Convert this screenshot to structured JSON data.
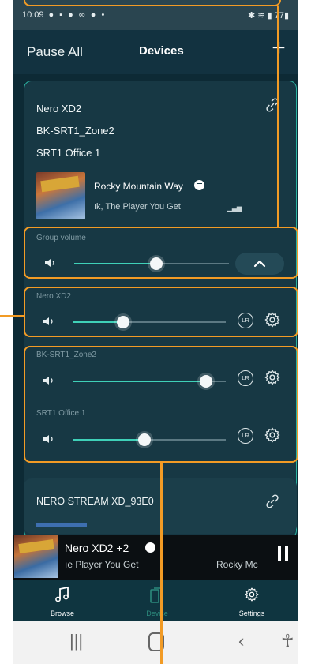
{
  "status_bar": {
    "time": "10:09",
    "battery": "77"
  },
  "header": {
    "pause_all": "Pause All",
    "title": "Devices",
    "add_icon": "plus-icon"
  },
  "group": {
    "devices": [
      "Nero XD2",
      "BK-SRT1_Zone2",
      "SRT1 Office 1"
    ],
    "track_title": "Rocky Mountain Way",
    "track_subtitle": "ık, The Player You Get",
    "group_volume_label": "Group volume",
    "group_volume": 0.53,
    "zones": [
      {
        "name": "Nero XD2",
        "volume": 0.33
      },
      {
        "name": "BK-SRT1_Zone2",
        "volume": 0.87
      },
      {
        "name": "SRT1 Office 1",
        "volume": 0.47
      }
    ],
    "lr_label": "LR"
  },
  "stream_card": {
    "name": "NERO STREAM XD_93E0"
  },
  "now_playing": {
    "title": "Nero XD2  +2",
    "subtitle": "ıe Player You Get",
    "artist": "Rocky Mc"
  },
  "tabs": [
    {
      "label": "Browse",
      "icon": "music-note-icon",
      "active": false
    },
    {
      "label": "Device",
      "icon": "devices-icon",
      "active": true
    },
    {
      "label": "Settings",
      "icon": "gear-icon",
      "active": false
    }
  ],
  "colors": {
    "accent": "#3fd1b8",
    "annotation": "#f29b25",
    "background": "#0d2a35"
  }
}
